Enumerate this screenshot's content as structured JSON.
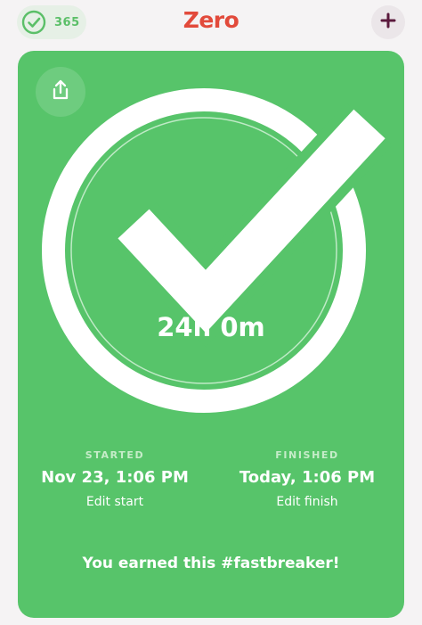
{
  "header": {
    "streak_count": "365",
    "streak_icon": "check-circle-icon",
    "title": "Zero",
    "add_icon": "plus-icon"
  },
  "card": {
    "share_icon": "share-icon",
    "completion_icon": "checkmark-icon",
    "duration": "24h 0m",
    "started_label": "STARTED",
    "started_value": "Nov 23, 1:06 PM",
    "edit_start": "Edit start",
    "finished_label": "FINISHED",
    "finished_value": "Today, 1:06 PM",
    "edit_finish": "Edit finish",
    "earned_text": "You earned this #fastbreaker!"
  },
  "colors": {
    "card_green": "#57c46a",
    "title_red": "#e24a3b",
    "plus_purple": "#5b1a3d",
    "background": "#f5f3f4"
  }
}
